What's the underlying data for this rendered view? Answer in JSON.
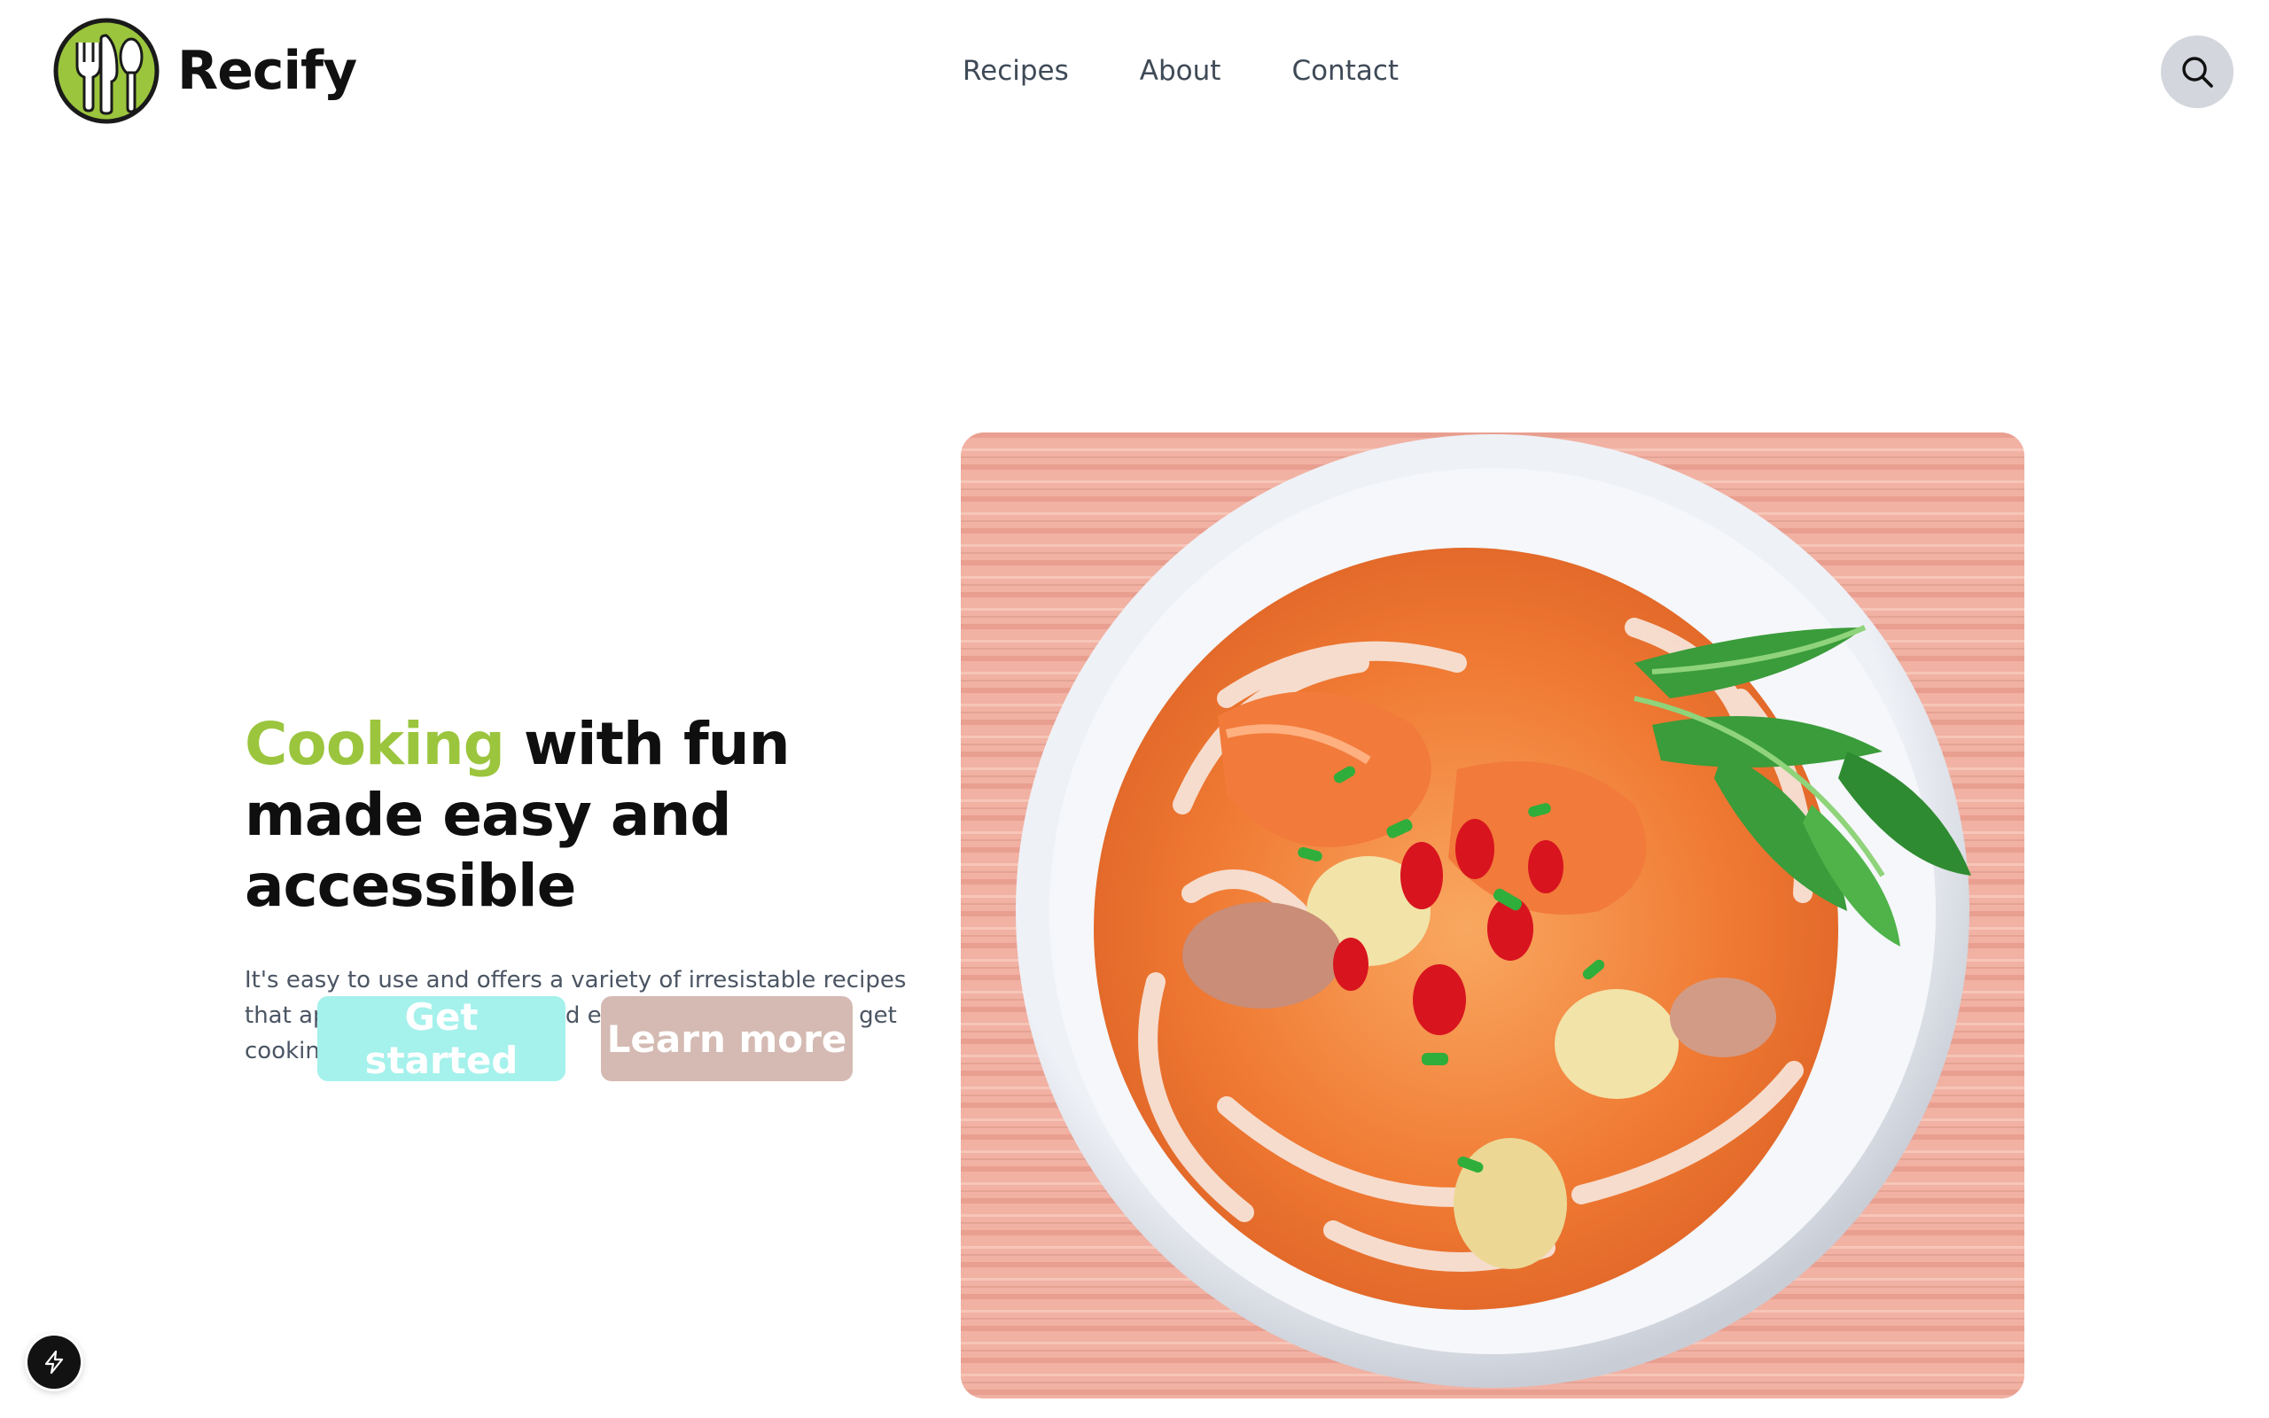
{
  "brand": {
    "name": "Recify",
    "logo_icon": "fork-knife-spoon-logo"
  },
  "nav": {
    "items": [
      {
        "label": "Recipes"
      },
      {
        "label": "About"
      },
      {
        "label": "Contact"
      }
    ]
  },
  "search": {
    "icon": "search-icon"
  },
  "hero": {
    "title_accent": "Cooking",
    "title_rest": " with fun made easy and accessible",
    "subtitle": "It's easy to use and offers a variety of irresistable recipes that appeal to beginners and experts alike. Ready to get cooking?",
    "primary_cta": "Get started",
    "secondary_cta": "Learn more",
    "image_icon": "food-bowl-image"
  },
  "colors": {
    "accent": "#9bc53d",
    "primary_button": "#a5f1ec",
    "secondary_button": "#d4bab2",
    "search_bg": "#d3d6dc"
  },
  "badge": {
    "icon": "lightning-bolt-icon"
  }
}
